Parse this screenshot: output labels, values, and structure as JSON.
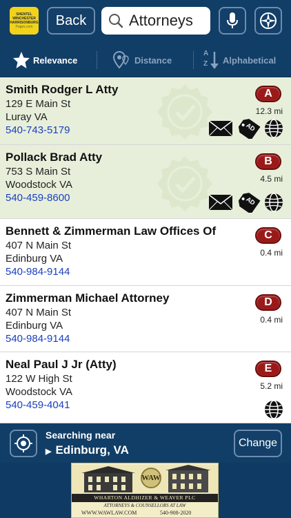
{
  "logo": {
    "lines": [
      "SHENTEL",
      "WINCHESTER",
      "HARRISONBURG",
      "Pages.com"
    ]
  },
  "header": {
    "back_label": "Back",
    "search_value": "Attorneys"
  },
  "sort": {
    "relevance": "Relevance",
    "distance": "Distance",
    "alphabetical": "Alphabetical",
    "alpha_icon_top": "A",
    "alpha_icon_bottom": "Z",
    "selected": "relevance"
  },
  "results": [
    {
      "name": "Smith Rodger L Atty",
      "street": "129 E Main St",
      "city": "Luray VA",
      "phone": "540-743-5179",
      "badge": "A",
      "distance": "12.3 mi",
      "featured": true,
      "ad_tag": "AD",
      "icons": [
        "mail-icon",
        "ad-tag-icon",
        "globe-icon"
      ]
    },
    {
      "name": "Pollack Brad Atty",
      "street": "753 S Main St",
      "city": "Woodstock VA",
      "phone": "540-459-8600",
      "badge": "B",
      "distance": "4.5 mi",
      "featured": true,
      "ad_tag": "AD",
      "icons": [
        "mail-icon",
        "ad-tag-icon",
        "globe-icon"
      ]
    },
    {
      "name": "Bennett & Zimmerman Law Offices Of",
      "street": "407 N Main St",
      "city": "Edinburg VA",
      "phone": "540-984-9144",
      "badge": "C",
      "distance": "0.4 mi",
      "featured": false,
      "icons": []
    },
    {
      "name": "Zimmerman Michael Attorney",
      "street": "407 N Main St",
      "city": "Edinburg VA",
      "phone": "540-984-9144",
      "badge": "D",
      "distance": "0.4 mi",
      "featured": false,
      "icons": []
    },
    {
      "name": "Neal Paul J Jr (Atty)",
      "street": "122 W High St",
      "city": "Woodstock VA",
      "phone": "540-459-4041",
      "badge": "E",
      "distance": "5.2 mi",
      "featured": false,
      "icons": [
        "globe-icon"
      ]
    }
  ],
  "location": {
    "label": "Searching near",
    "city": "Edinburg, VA",
    "change_label": "Change"
  },
  "ad": {
    "monogram": "WAW",
    "firm": "WHARTON ALDHIZER & WEAVER PLC",
    "tagline": "ATTORNEYS & COUNSELLORS AT LAW",
    "website": "WWW.WAWLAW.COM",
    "phone": "540-908-2020"
  },
  "colors": {
    "bar_bg": "#113e66",
    "badge_red": "#9a1a1a",
    "featured_row": "#e7efda",
    "phone_link": "#1a3fbf"
  }
}
